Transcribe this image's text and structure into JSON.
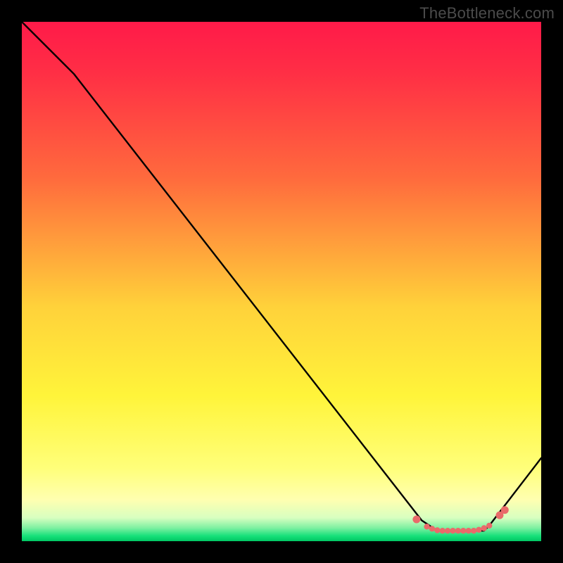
{
  "watermark": "TheBottleneck.com",
  "colors": {
    "bg": "#000000",
    "curve": "#000000",
    "markers": "#e96a6a",
    "gradient_top": "#ff1a49",
    "gradient_mid1": "#ff6a3d",
    "gradient_mid2": "#ffd23a",
    "gradient_mid3": "#fff43a",
    "gradient_pale": "#ffffb0",
    "gradient_green": "#16e07a"
  },
  "chart_data": {
    "type": "line",
    "title": "",
    "xlabel": "",
    "ylabel": "",
    "xlim": [
      0,
      100
    ],
    "ylim": [
      0,
      100
    ],
    "series": [
      {
        "name": "curve",
        "x": [
          0,
          8,
          10,
          77,
          80,
          89,
          90,
          100
        ],
        "y": [
          100,
          92,
          90,
          4,
          2,
          2,
          3,
          16
        ]
      }
    ],
    "markers": {
      "name": "flat-bottom-points",
      "x": [
        76,
        78,
        79,
        80,
        81,
        82,
        83,
        84,
        85,
        86,
        87,
        88,
        89,
        90,
        92,
        93
      ],
      "y": [
        4.2,
        2.8,
        2.4,
        2.1,
        2.0,
        2.0,
        2.0,
        2.0,
        2.0,
        2.0,
        2.0,
        2.2,
        2.5,
        3.0,
        5.0,
        6.0
      ]
    }
  }
}
